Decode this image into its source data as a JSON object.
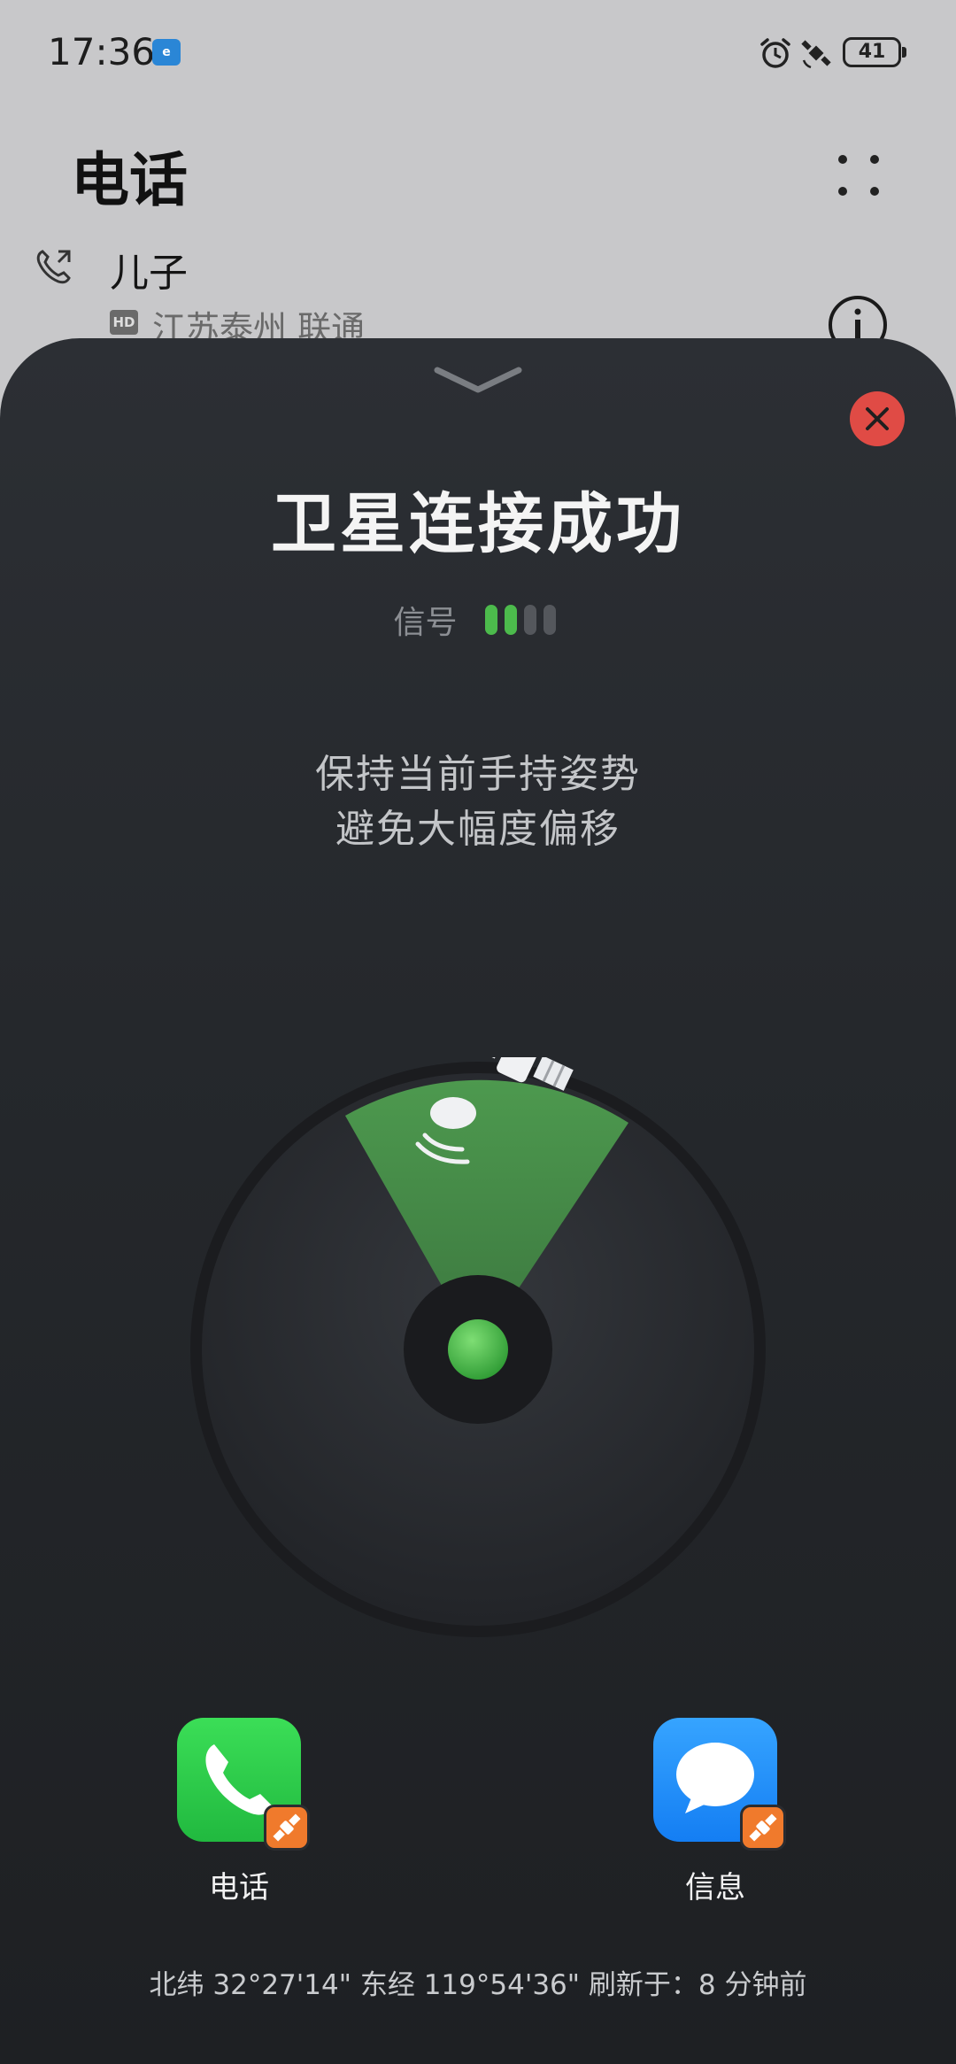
{
  "status_bar": {
    "time": "17:36",
    "battery": "41",
    "icons": [
      "app-notification-icon",
      "alarm-icon",
      "satellite-icon",
      "battery-icon"
    ]
  },
  "background_app": {
    "title": "电话",
    "recent_call": {
      "name": "儿子",
      "badge": "HD",
      "location": "江苏泰州 联通"
    }
  },
  "sheet": {
    "title": "卫星连接成功",
    "signal_label": "信号",
    "signal_strength": 2,
    "signal_max": 4,
    "hint_line1": "保持当前手持姿势",
    "hint_line2": "避免大幅度偏移",
    "apps": [
      {
        "label": "电话",
        "icon": "phone-icon"
      },
      {
        "label": "信息",
        "icon": "message-icon"
      }
    ],
    "coordinates": "北纬 32°27'14\" 东经 119°54'36\" 刷新于：8 分钟前"
  },
  "colors": {
    "accent_green": "#4cbb4c",
    "close_red": "#e04b45",
    "badge_orange": "#f07a2c",
    "sheet_bg": "#26292d"
  }
}
